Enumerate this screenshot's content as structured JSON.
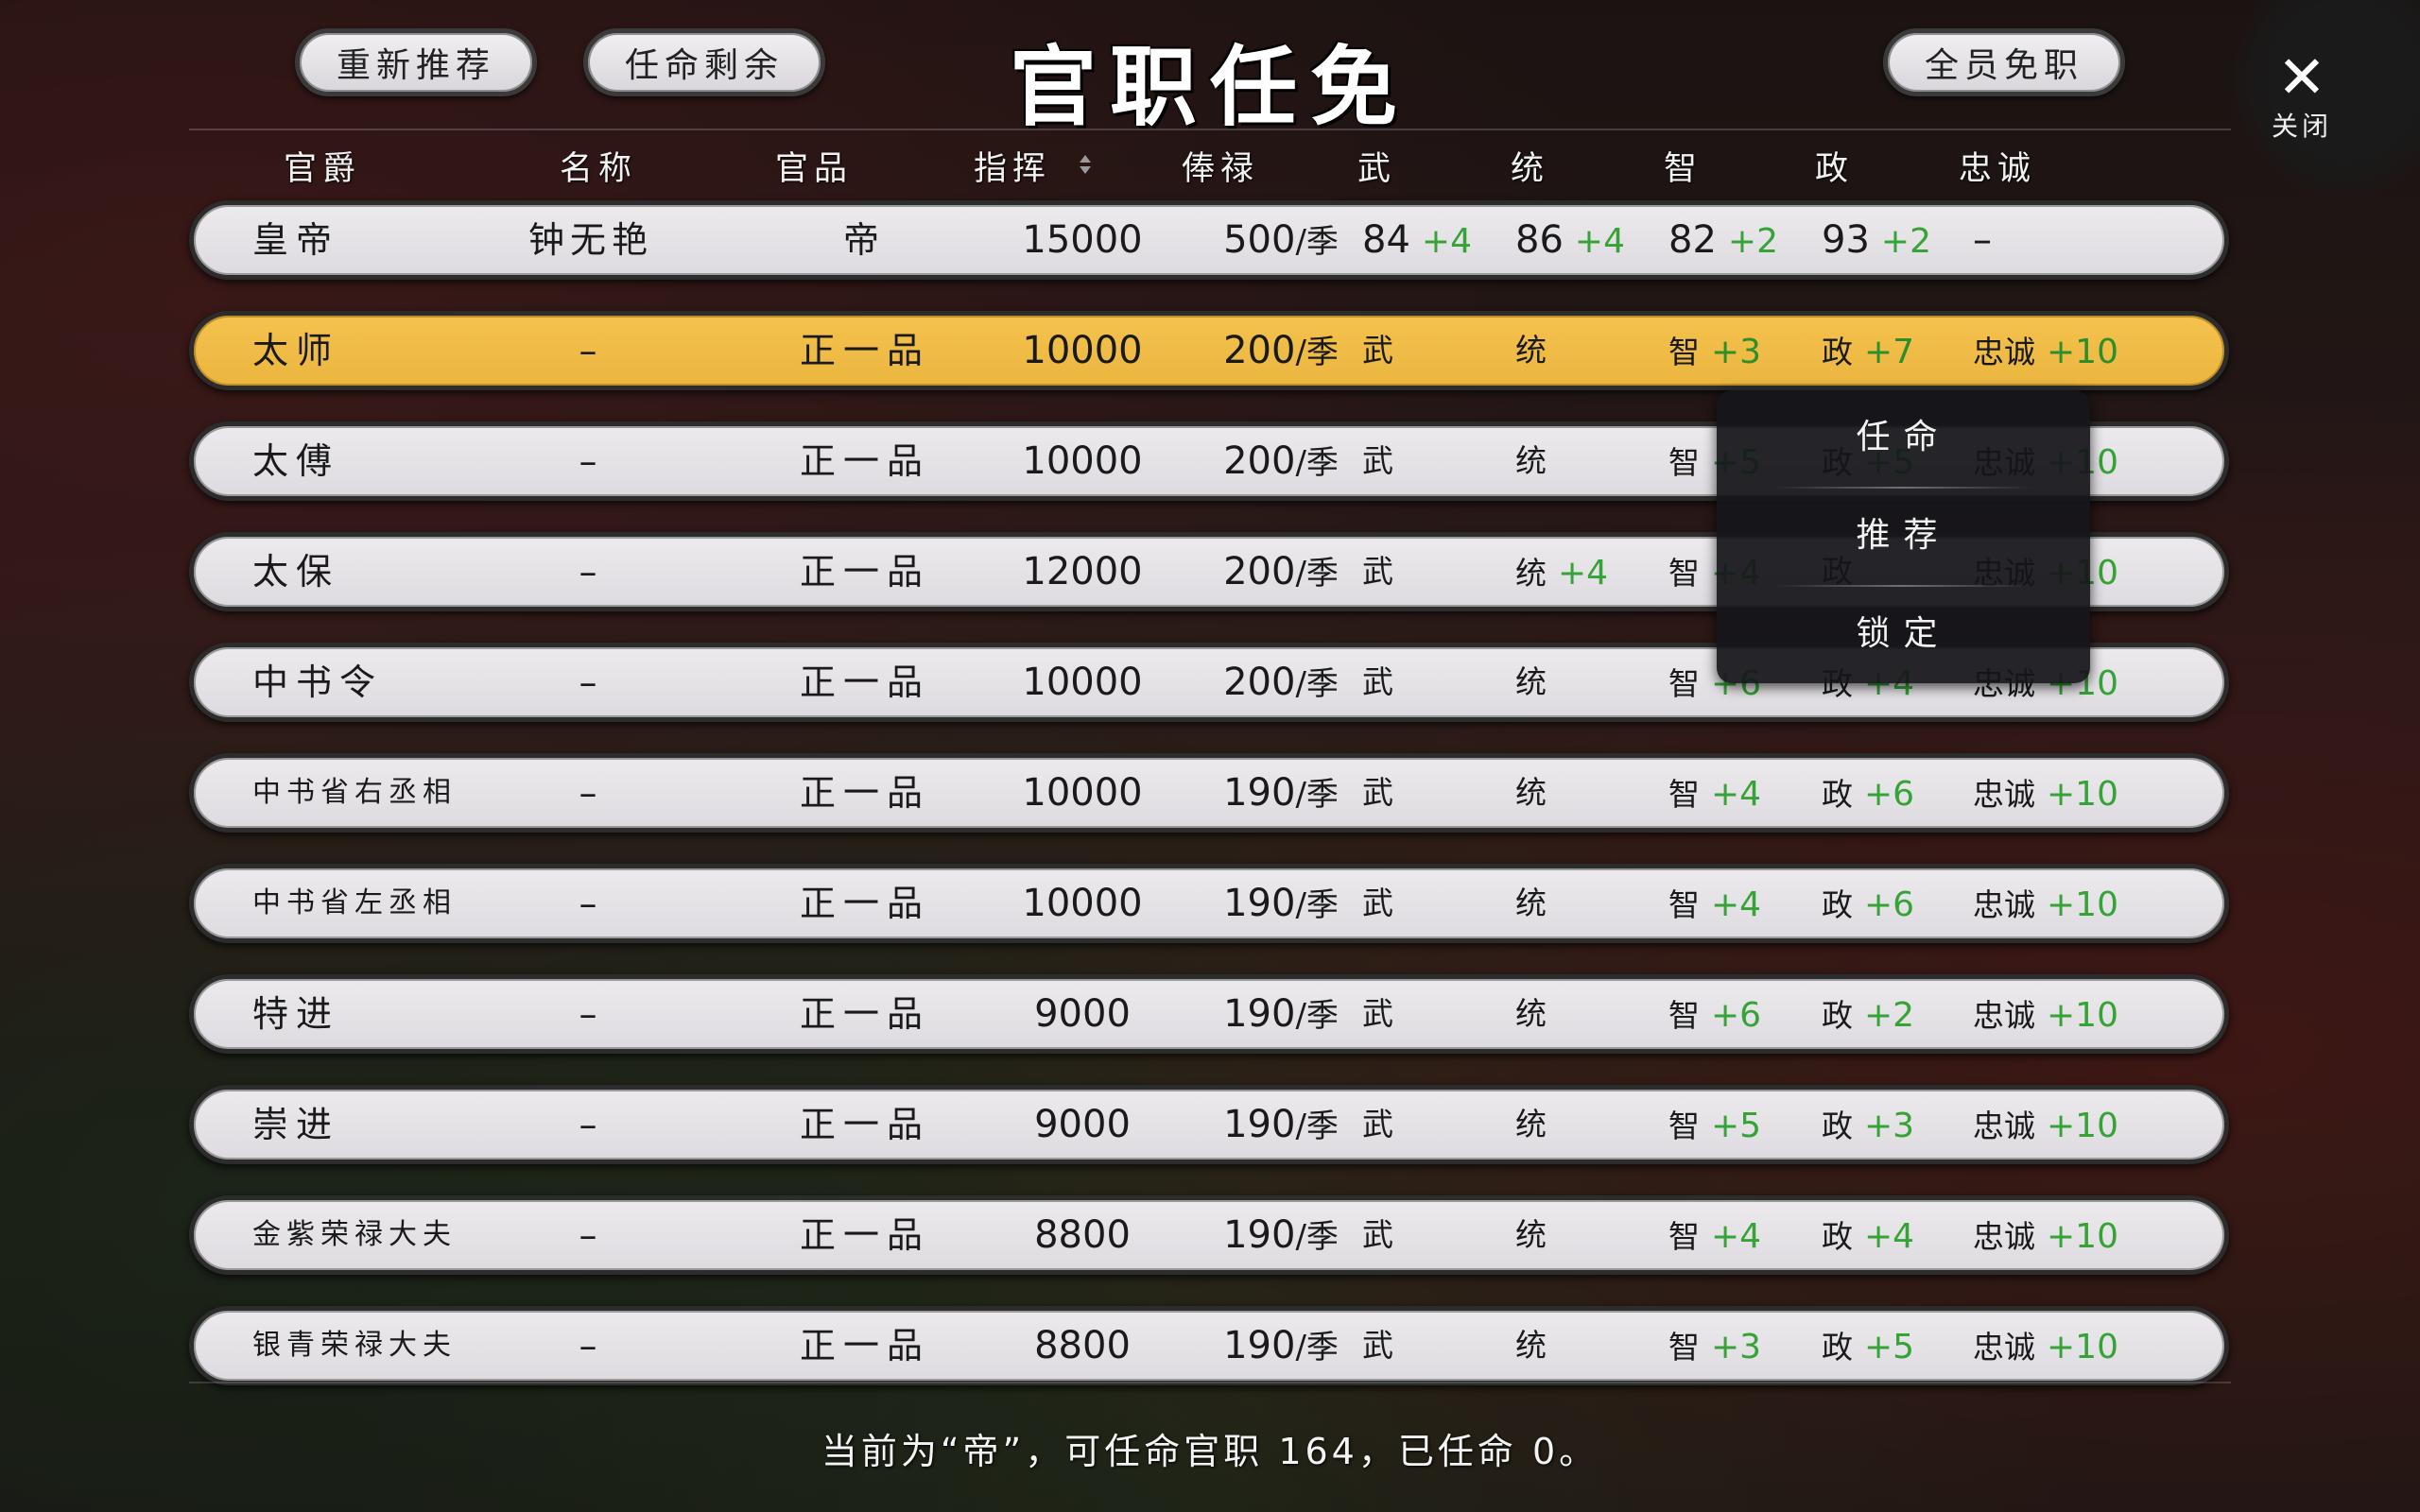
{
  "header": {
    "title": "官职任免",
    "recommend_label": "重新推荐",
    "remaining_label": "任命剩余",
    "dismiss_all_label": "全员免职",
    "close_label": "关闭"
  },
  "columns": {
    "rank": "官爵",
    "name": "名称",
    "grade": "官品",
    "command": "指挥",
    "salary": "俸禄",
    "wu": "武",
    "tong": "统",
    "zhi": "智",
    "zheng": "政",
    "loyalty": "忠诚"
  },
  "rows": [
    {
      "title": "皇帝",
      "name": "钟无艳",
      "grade": "帝",
      "command": "15000",
      "salary": "500",
      "salary_unit": "/季",
      "wu": "84",
      "wu_bonus": "+4",
      "tong": "86",
      "tong_bonus": "+4",
      "zhi": "82",
      "zhi_bonus": "+2",
      "zheng": "93",
      "zheng_bonus": "+2",
      "loyalty": "–"
    },
    {
      "title": "太师",
      "name": "–",
      "grade": "正一品",
      "command": "10000",
      "salary": "200",
      "salary_unit": "/季",
      "wu": "武",
      "tong": "统",
      "zhi": "智",
      "zhi_bonus": "+3",
      "zheng": "政",
      "zheng_bonus": "+7",
      "loyalty": "忠诚",
      "loyalty_bonus": "+10"
    },
    {
      "title": "太傅",
      "name": "–",
      "grade": "正一品",
      "command": "10000",
      "salary": "200",
      "salary_unit": "/季",
      "wu": "武",
      "tong": "统",
      "zhi": "智",
      "zhi_bonus": "+5",
      "zheng": "政",
      "zheng_bonus": "+5",
      "loyalty": "忠诚",
      "loyalty_bonus": "+10"
    },
    {
      "title": "太保",
      "name": "–",
      "grade": "正一品",
      "command": "12000",
      "salary": "200",
      "salary_unit": "/季",
      "wu": "武",
      "tong": "统",
      "tong_bonus": "+4",
      "zhi": "智",
      "zhi_bonus": "+4",
      "zheng": "政",
      "loyalty": "忠诚",
      "loyalty_bonus": "+10"
    },
    {
      "title": "中书令",
      "name": "–",
      "grade": "正一品",
      "command": "10000",
      "salary": "200",
      "salary_unit": "/季",
      "wu": "武",
      "tong": "统",
      "zhi": "智",
      "zhi_bonus": "+6",
      "zheng": "政",
      "zheng_bonus": "+4",
      "loyalty": "忠诚",
      "loyalty_bonus": "+10"
    },
    {
      "title": "中书省右丞相",
      "name": "–",
      "grade": "正一品",
      "command": "10000",
      "salary": "190",
      "salary_unit": "/季",
      "wu": "武",
      "tong": "统",
      "zhi": "智",
      "zhi_bonus": "+4",
      "zheng": "政",
      "zheng_bonus": "+6",
      "loyalty": "忠诚",
      "loyalty_bonus": "+10"
    },
    {
      "title": "中书省左丞相",
      "name": "–",
      "grade": "正一品",
      "command": "10000",
      "salary": "190",
      "salary_unit": "/季",
      "wu": "武",
      "tong": "统",
      "zhi": "智",
      "zhi_bonus": "+4",
      "zheng": "政",
      "zheng_bonus": "+6",
      "loyalty": "忠诚",
      "loyalty_bonus": "+10"
    },
    {
      "title": "特进",
      "name": "–",
      "grade": "正一品",
      "command": "9000",
      "salary": "190",
      "salary_unit": "/季",
      "wu": "武",
      "tong": "统",
      "zhi": "智",
      "zhi_bonus": "+6",
      "zheng": "政",
      "zheng_bonus": "+2",
      "loyalty": "忠诚",
      "loyalty_bonus": "+10"
    },
    {
      "title": "崇进",
      "name": "–",
      "grade": "正一品",
      "command": "9000",
      "salary": "190",
      "salary_unit": "/季",
      "wu": "武",
      "tong": "统",
      "zhi": "智",
      "zhi_bonus": "+5",
      "zheng": "政",
      "zheng_bonus": "+3",
      "loyalty": "忠诚",
      "loyalty_bonus": "+10"
    },
    {
      "title": "金紫荣禄大夫",
      "name": "–",
      "grade": "正一品",
      "command": "8800",
      "salary": "190",
      "salary_unit": "/季",
      "wu": "武",
      "tong": "统",
      "zhi": "智",
      "zhi_bonus": "+4",
      "zheng": "政",
      "zheng_bonus": "+4",
      "loyalty": "忠诚",
      "loyalty_bonus": "+10"
    },
    {
      "title": "银青荣禄大夫",
      "name": "–",
      "grade": "正一品",
      "command": "8800",
      "salary": "190",
      "salary_unit": "/季",
      "wu": "武",
      "tong": "统",
      "zhi": "智",
      "zhi_bonus": "+3",
      "zheng": "政",
      "zheng_bonus": "+5",
      "loyalty": "忠诚",
      "loyalty_bonus": "+10"
    }
  ],
  "context_menu": {
    "appoint": "任命",
    "recommend": "推荐",
    "lock": "锁定"
  },
  "status_text": "当前为“帝”，可任命官职 164，已任命 0。",
  "icons": {
    "close": "close-icon",
    "sort": "sort-icon"
  },
  "colors": {
    "selected_row": "#f0bc45",
    "bonus_green": "#35a335",
    "row_bg": "#e6e3e8"
  }
}
